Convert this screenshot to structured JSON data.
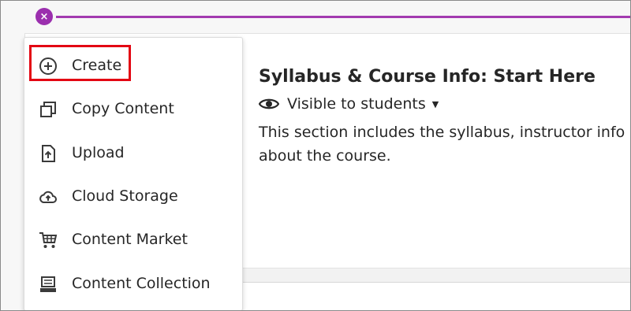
{
  "accent_color": "#a33bb0",
  "highlight_color": "#e30613",
  "close_button": {
    "icon": "close-icon",
    "symbol": "×"
  },
  "section": {
    "title": "Syllabus & Course Info: Start Here",
    "visibility_label": "Visible to students",
    "description": "This section includes the syllabus, instructor info about the course."
  },
  "menu": {
    "items": [
      {
        "label": "Create",
        "icon": "plus-circle-icon"
      },
      {
        "label": "Copy Content",
        "icon": "copy-icon"
      },
      {
        "label": "Upload",
        "icon": "upload-icon"
      },
      {
        "label": "Cloud Storage",
        "icon": "cloud-upload-icon"
      },
      {
        "label": "Content Market",
        "icon": "cart-icon"
      },
      {
        "label": "Content Collection",
        "icon": "collection-icon"
      }
    ]
  }
}
